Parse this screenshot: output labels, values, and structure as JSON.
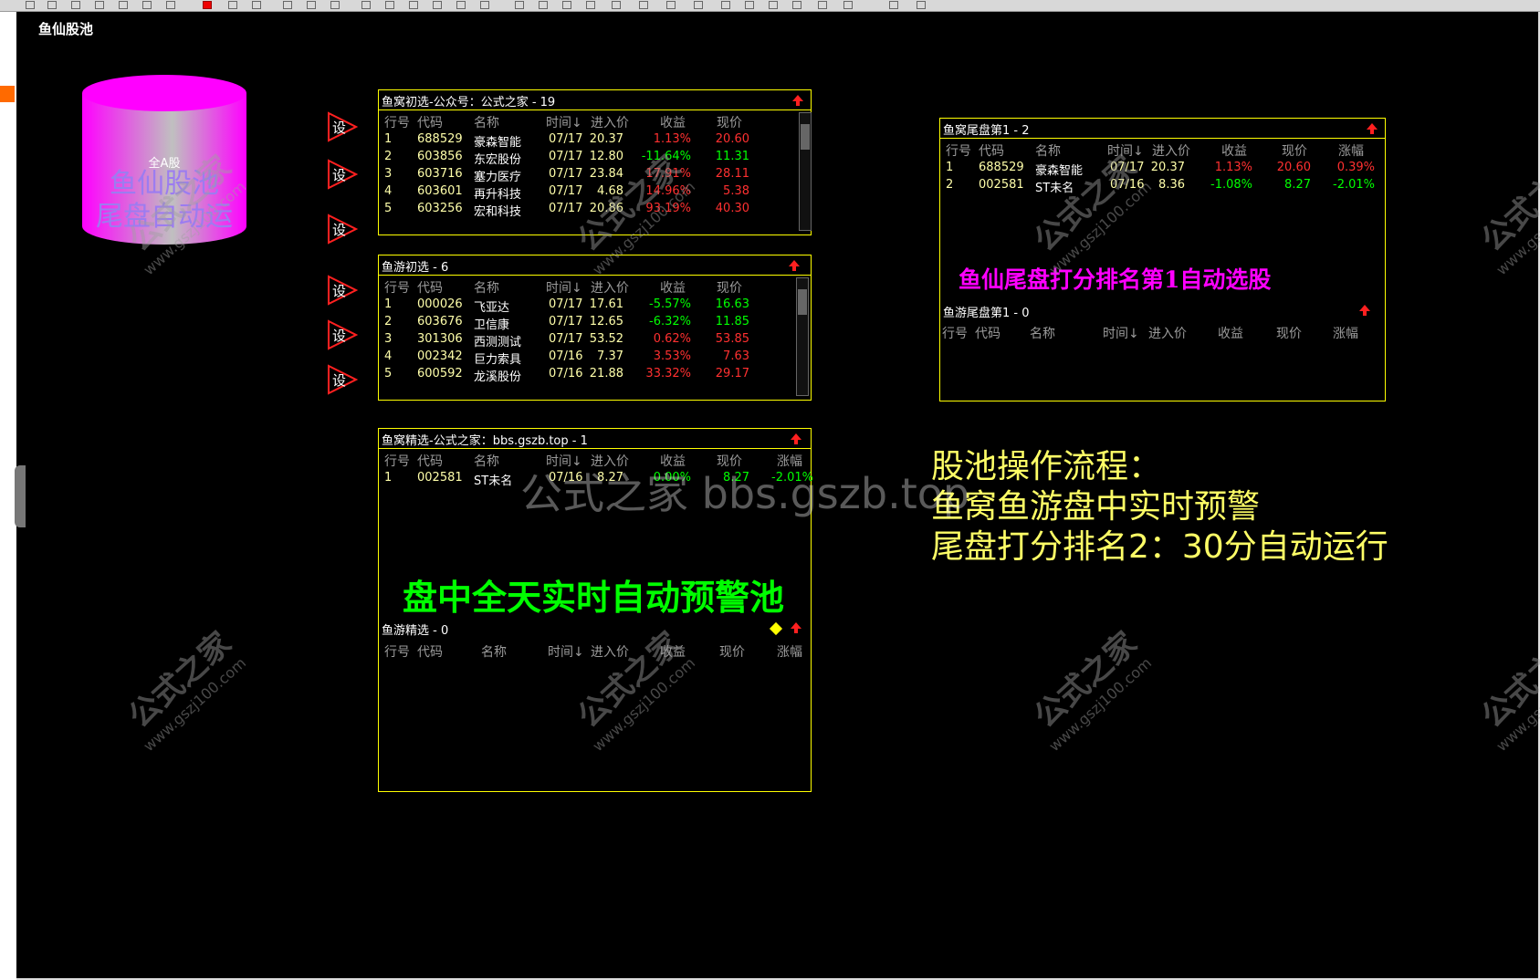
{
  "colors": {
    "background": "#000000",
    "panel_border": "#ffff00",
    "up": "#ff3030",
    "down": "#00ff00",
    "neutral": "#ffffaa",
    "text": "#ffffff",
    "header": "#9a9a9a",
    "magenta": "#ff00ff",
    "green_title": "#00ff00"
  },
  "page_title": "鱼仙股池",
  "cylinder": {
    "small_label": "全A股",
    "line1": "鱼仙股池",
    "line2": "尾盘自动运"
  },
  "set_button_label": "设",
  "arrow_icon": "up-arrow-icon",
  "panels": {
    "yuwo_chuxuan": {
      "title": "鱼窝初选-公众号：公式之家 - 19",
      "headers": [
        "行号",
        "代码",
        "名称",
        "时间↓",
        "进入价",
        "收益",
        "现价"
      ],
      "rows": [
        {
          "n": "1",
          "code": "688529",
          "name": "豪森智能",
          "time": "07/17",
          "entry": "20.37",
          "ret": "1.13%",
          "price": "20.60",
          "dir": "up"
        },
        {
          "n": "2",
          "code": "603856",
          "name": "东宏股份",
          "time": "07/17",
          "entry": "12.80",
          "ret": "-11.64%",
          "price": "11.31",
          "dir": "down"
        },
        {
          "n": "3",
          "code": "603716",
          "name": "塞力医疗",
          "time": "07/17",
          "entry": "23.84",
          "ret": "17.91%",
          "price": "28.11",
          "dir": "up"
        },
        {
          "n": "4",
          "code": "603601",
          "name": "再升科技",
          "time": "07/17",
          "entry": "4.68",
          "ret": "14.96%",
          "price": "5.38",
          "dir": "up"
        },
        {
          "n": "5",
          "code": "603256",
          "name": "宏和科技",
          "time": "07/17",
          "entry": "20.86",
          "ret": "93.19%",
          "price": "40.30",
          "dir": "up"
        }
      ]
    },
    "yuyou_chuxuan": {
      "title": "鱼游初选 - 6",
      "headers": [
        "行号",
        "代码",
        "名称",
        "时间↓",
        "进入价",
        "收益",
        "现价"
      ],
      "rows": [
        {
          "n": "1",
          "code": "000026",
          "name": "飞亚达",
          "time": "07/17",
          "entry": "17.61",
          "ret": "-5.57%",
          "price": "16.63",
          "dir": "down"
        },
        {
          "n": "2",
          "code": "603676",
          "name": "卫信康",
          "time": "07/17",
          "entry": "12.65",
          "ret": "-6.32%",
          "price": "11.85",
          "dir": "down"
        },
        {
          "n": "3",
          "code": "301306",
          "name": "西测测试",
          "time": "07/17",
          "entry": "53.52",
          "ret": "0.62%",
          "price": "53.85",
          "dir": "up"
        },
        {
          "n": "4",
          "code": "002342",
          "name": "巨力索具",
          "time": "07/16",
          "entry": "7.37",
          "ret": "3.53%",
          "price": "7.63",
          "dir": "up"
        },
        {
          "n": "5",
          "code": "600592",
          "name": "龙溪股份",
          "time": "07/16",
          "entry": "21.88",
          "ret": "33.32%",
          "price": "29.17",
          "dir": "up"
        }
      ]
    },
    "yuwo_jingxuan": {
      "title": "鱼窝精选-公式之家：bbs.gszb.top - 1",
      "headers": [
        "行号",
        "代码",
        "名称",
        "时间↓",
        "进入价",
        "收益",
        "现价",
        "涨幅"
      ],
      "rows": [
        {
          "n": "1",
          "code": "002581",
          "name": "ST未名",
          "time": "07/16",
          "entry": "8.27",
          "ret": "0.00%",
          "price": "8.27",
          "chg": "-2.01%",
          "dir": "down"
        }
      ],
      "big_label": "盘中全天实时自动预警池"
    },
    "yuyou_jingxuan": {
      "title": "鱼游精选 - 0",
      "headers": [
        "行号",
        "代码",
        "名称",
        "时间↓",
        "进入价",
        "收益",
        "现价",
        "涨幅"
      ]
    },
    "yuwo_weipan": {
      "title": "鱼窝尾盘第1 - 2",
      "headers": [
        "行号",
        "代码",
        "名称",
        "时间↓",
        "进入价",
        "收益",
        "现价",
        "涨幅"
      ],
      "rows": [
        {
          "n": "1",
          "code": "688529",
          "name": "豪森智能",
          "time": "07/17",
          "entry": "20.37",
          "ret": "1.13%",
          "price": "20.60",
          "chg": "0.39%",
          "dir": "up"
        },
        {
          "n": "2",
          "code": "002581",
          "name": "ST未名",
          "time": "07/16",
          "entry": "8.36",
          "ret": "-1.08%",
          "price": "8.27",
          "chg": "-2.01%",
          "dir": "down"
        }
      ],
      "big_label": "鱼仙尾盘打分排名第1自动选股"
    },
    "yuyou_weipan": {
      "title": "鱼游尾盘第1 - 0",
      "headers": [
        "行号",
        "代码",
        "名称",
        "时间↓",
        "进入价",
        "收益",
        "现价",
        "涨幅"
      ]
    }
  },
  "flow": {
    "line1": "股池操作流程：",
    "line2": "鱼窝鱼游盘中实时预警",
    "line3": "尾盘打分排名2：30分自动运行"
  },
  "watermark": {
    "center": "公式之家 bbs.gszb.top",
    "diag_main": "公式之家",
    "diag_url": "www.gszj100.com"
  }
}
